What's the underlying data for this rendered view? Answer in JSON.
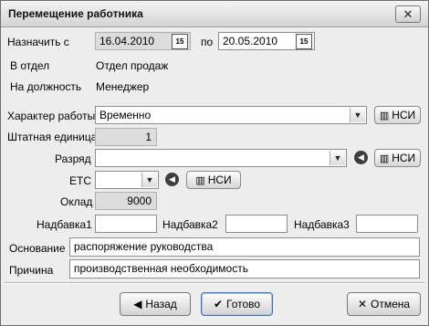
{
  "window": {
    "title": "Перемещение работника",
    "close_glyph": "✕"
  },
  "assign": {
    "label": "Назначить с",
    "date_from": "16.04.2010",
    "to_label": "по",
    "date_to": "20.05.2010",
    "cal_icon": "15"
  },
  "info": {
    "dept_label": "В отдел",
    "dept_value": "Отдел продаж",
    "position_label": "На должность",
    "position_value": "Менеджер"
  },
  "work": {
    "type_label": "Характер работы",
    "type_value": "Временно",
    "nsi_label": "НСИ",
    "unit_label": "Штатная единица",
    "unit_value": "1"
  },
  "grade": {
    "label": "Разряд",
    "value": "",
    "nsi_label": "НСИ"
  },
  "ets": {
    "label": "ЕТС",
    "value": "",
    "nsi_label": "НСИ"
  },
  "salary": {
    "label": "Оклад",
    "value": "9000"
  },
  "bonuses": [
    {
      "label": "Надбавка1",
      "value": ""
    },
    {
      "label": "Надбавка2",
      "value": ""
    },
    {
      "label": "Надбавка3",
      "value": ""
    }
  ],
  "basis": {
    "label": "Основание",
    "value": "распоряжение руководства"
  },
  "reason": {
    "label": "Причина",
    "value": "производственная необходимость"
  },
  "buttons": {
    "back": "Назад",
    "done": "Готово",
    "cancel": "Отмена"
  }
}
